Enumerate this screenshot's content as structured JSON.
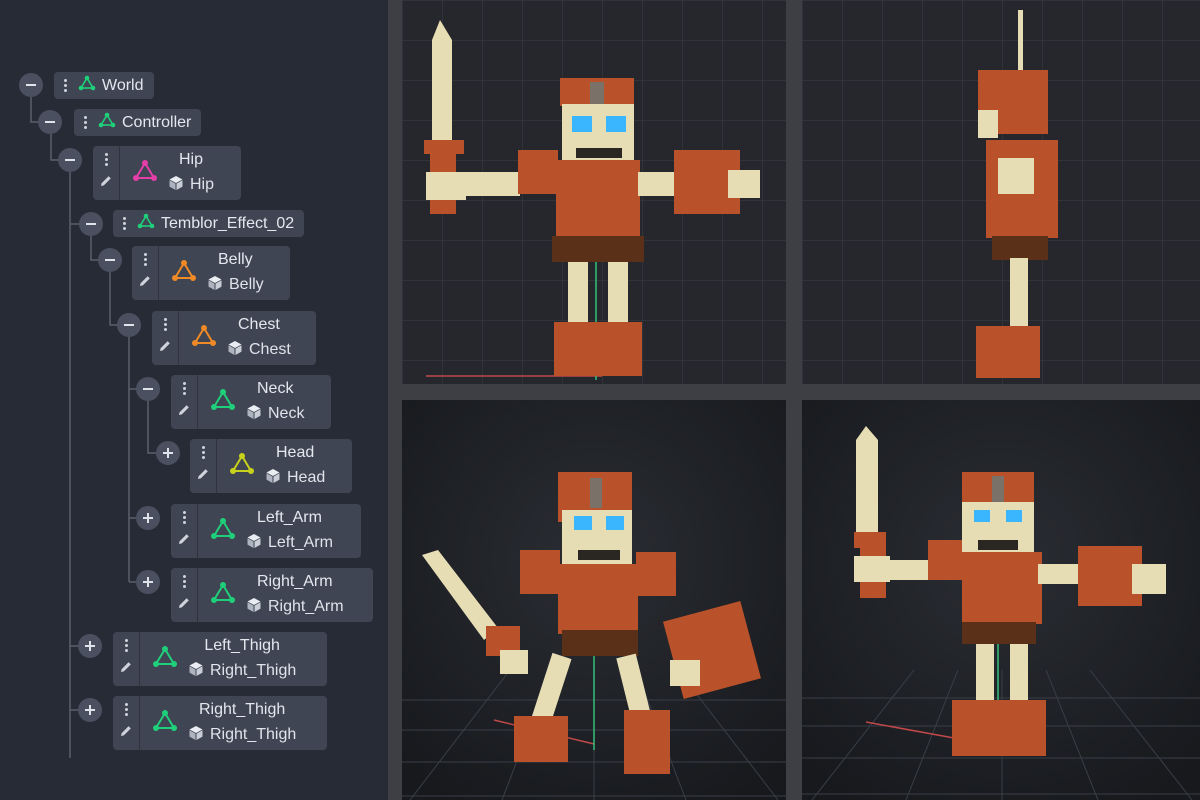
{
  "colors": {
    "panel_bg": "#262b35",
    "node_bg": "#3f4553",
    "toggle_bg": "#4a5060",
    "line": "#5a606c",
    "green": "#1fd07a",
    "pink": "#e53ea8",
    "orange": "#f08a24",
    "yellow": "#c9d21a",
    "armor": "#b9522a",
    "bone": "#e7ddb4",
    "eye": "#3ab6ff"
  },
  "tree": {
    "world": {
      "label": "World",
      "icon": "node-icon"
    },
    "controller": {
      "label": "Controller",
      "icon": "node-icon"
    },
    "hip": {
      "label": "Hip",
      "mesh": "Hip",
      "icon": "bone-icon"
    },
    "temblor": {
      "label": "Temblor_Effect_02",
      "icon": "node-icon"
    },
    "belly": {
      "label": "Belly",
      "mesh": "Belly",
      "icon": "bone-icon"
    },
    "chest": {
      "label": "Chest",
      "mesh": "Chest",
      "icon": "bone-icon"
    },
    "neck": {
      "label": "Neck",
      "mesh": "Neck",
      "icon": "bone-icon"
    },
    "head": {
      "label": "Head",
      "mesh": "Head",
      "icon": "bone-icon"
    },
    "left_arm": {
      "label": "Left_Arm",
      "mesh": "Left_Arm",
      "icon": "bone-icon"
    },
    "right_arm": {
      "label": "Right_Arm",
      "mesh": "Right_Arm",
      "icon": "bone-icon"
    },
    "left_thigh": {
      "label": "Left_Thigh",
      "mesh": "Right_Thigh",
      "icon": "bone-icon"
    },
    "right_thigh": {
      "label": "Right_Thigh",
      "mesh": "Right_Thigh",
      "icon": "bone-icon"
    }
  },
  "viewports": [
    {
      "view": "front-orthographic"
    },
    {
      "view": "side-orthographic"
    },
    {
      "view": "perspective-pose"
    },
    {
      "view": "perspective-front"
    }
  ]
}
